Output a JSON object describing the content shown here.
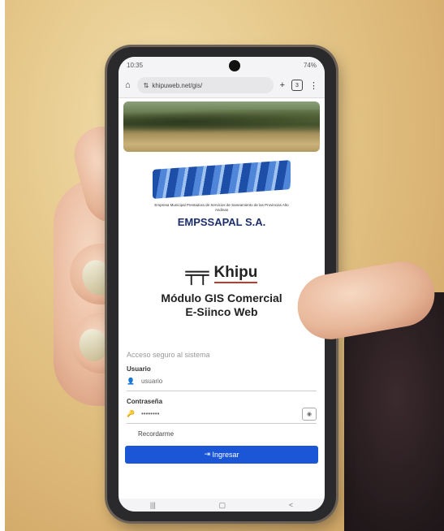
{
  "status_bar": {
    "time": "10:35",
    "battery": "74%"
  },
  "browser": {
    "url": "khipuweb.net/gis/",
    "tab_count": "3"
  },
  "logo": {
    "caption": "Empresa Municipal Prestadora de Servicios de Saneamiento de las Provincias Alto Andinas",
    "company_name": "EMPSSAPAL S.A."
  },
  "khipu": {
    "name": "Khipu"
  },
  "module_title": [
    "Módulo GIS Comercial",
    "E-Siinco Web"
  ],
  "form": {
    "hint": "Acceso seguro al sistema",
    "user_label": "Usuario",
    "user_value": "usuario",
    "password_label": "Contraseña",
    "password_value": "••••••••",
    "remember_label": "Recordarme",
    "login_label": "Ingresar"
  },
  "icons": {
    "home": "home-icon",
    "lock": "lock-icon",
    "user": "user-icon",
    "key": "key-icon",
    "eye": "eye-icon",
    "plus": "plus-icon",
    "menu": "menu-icon",
    "login": "login-icon"
  },
  "colors": {
    "primary": "#1a56d6",
    "logo_blue": "#1d4fa8",
    "accent_red": "#c0392b"
  }
}
